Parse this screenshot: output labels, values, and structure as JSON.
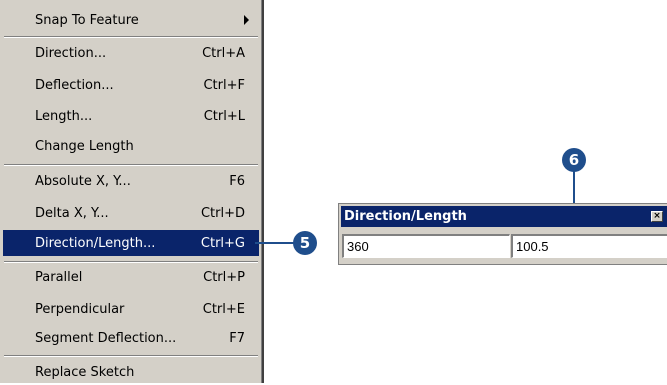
{
  "menu": {
    "items": [
      {
        "label": "Snap To Feature",
        "shortcut": ""
      },
      {
        "label": "Direction...",
        "shortcut": "Ctrl+A"
      },
      {
        "label": "Deflection...",
        "shortcut": "Ctrl+F"
      },
      {
        "label": "Length...",
        "shortcut": "Ctrl+L"
      },
      {
        "label": "Change Length",
        "shortcut": ""
      },
      {
        "label": "Absolute X, Y...",
        "shortcut": "F6"
      },
      {
        "label": "Delta X, Y...",
        "shortcut": "Ctrl+D"
      },
      {
        "label": "Direction/Length...",
        "shortcut": "Ctrl+G"
      },
      {
        "label": "Parallel",
        "shortcut": "Ctrl+P"
      },
      {
        "label": "Perpendicular",
        "shortcut": "Ctrl+E"
      },
      {
        "label": "Segment Deflection...",
        "shortcut": "F7"
      },
      {
        "label": "Replace Sketch",
        "shortcut": ""
      }
    ],
    "selected_label": "Direction/Length...",
    "submenu_icon": "chevron-right-icon"
  },
  "dialog": {
    "title": "Direction/Length",
    "close_label": "×",
    "direction_value": "360",
    "length_value": "100.5"
  },
  "callouts": {
    "step5": "5",
    "step6": "6"
  },
  "colors": {
    "menu_bg": "#d4d0c8",
    "selection": "#0a246a",
    "callout": "#1f4e8c"
  }
}
